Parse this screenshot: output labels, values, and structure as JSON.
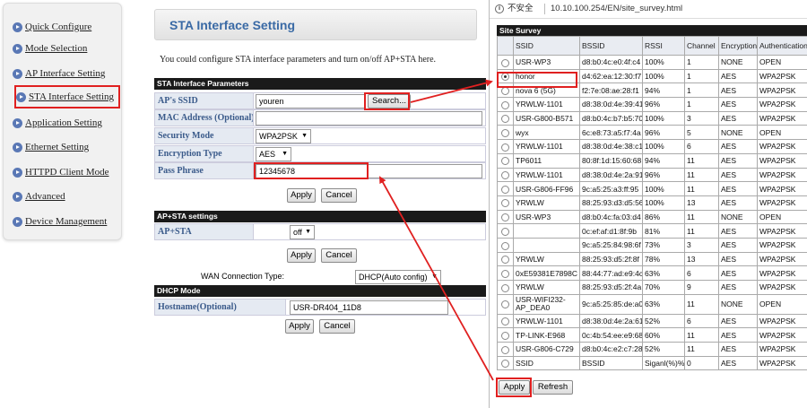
{
  "sidebar": {
    "items": [
      {
        "label": "Quick Configure"
      },
      {
        "label": "Mode Selection"
      },
      {
        "label": "AP Interface Setting"
      },
      {
        "label": "STA Interface Setting"
      },
      {
        "label": "Application Setting"
      },
      {
        "label": "Ethernet Setting"
      },
      {
        "label": "HTTPD Client Mode"
      },
      {
        "label": "Advanced"
      },
      {
        "label": "Device Management"
      }
    ]
  },
  "main": {
    "title": "STA Interface Setting",
    "description": "You could configure STA interface parameters and turn on/off AP+STA here.",
    "sta_params": {
      "header": "STA Interface Parameters",
      "ssid_label": "AP's SSID",
      "ssid_value": "youren",
      "search_label": "Search...",
      "mac_label": "MAC Address (Optional)",
      "mac_value": "",
      "security_label": "Security Mode",
      "security_value": "WPA2PSK",
      "encryption_label": "Encryption Type",
      "encryption_value": "AES",
      "pass_label": "Pass Phrase",
      "pass_value": "12345678",
      "apply_label": "Apply",
      "cancel_label": "Cancel"
    },
    "apsta": {
      "header": "AP+STA settings",
      "label": "AP+STA",
      "value": "off",
      "apply_label": "Apply",
      "cancel_label": "Cancel"
    },
    "wan": {
      "label": "WAN Connection Type:",
      "value": "DHCP(Auto config)"
    },
    "dhcp": {
      "header": "DHCP Mode",
      "hostname_label": "Hostname(Optional)",
      "hostname_value": "USR-DR404_11D8",
      "apply_label": "Apply",
      "cancel_label": "Cancel"
    }
  },
  "browser": {
    "security_text": "不安全",
    "url": "10.10.100.254/EN/site_survey.html"
  },
  "site_survey": {
    "header": "Site Survey",
    "columns": [
      "",
      "SSID",
      "BSSID",
      "RSSI",
      "Channel",
      "Encryption",
      "Authentication"
    ],
    "rows": [
      [
        "USR-WP3",
        "d8:b0:4c:e0:4f:c4",
        "100%",
        "1",
        "NONE",
        "OPEN"
      ],
      [
        "honor",
        "d4:62:ea:12:30:f7",
        "100%",
        "1",
        "AES",
        "WPA2PSK"
      ],
      [
        "nova 6 (5G)",
        "f2:7e:08:ae:28:f1",
        "94%",
        "1",
        "AES",
        "WPA2PSK"
      ],
      [
        "YRWLW-1101",
        "d8:38:0d:4e:39:41",
        "96%",
        "1",
        "AES",
        "WPA2PSK"
      ],
      [
        "USR-G800-B571",
        "d8:b0:4c:b7:b5:70",
        "100%",
        "3",
        "AES",
        "WPA2PSK"
      ],
      [
        "wyx",
        "6c:e8:73:a5:f7:4a",
        "96%",
        "5",
        "NONE",
        "OPEN"
      ],
      [
        "YRWLW-1101",
        "d8:38:0d:4e:38:c1",
        "100%",
        "6",
        "AES",
        "WPA2PSK"
      ],
      [
        "TP6011",
        "80:8f:1d:15:60:68",
        "94%",
        "11",
        "AES",
        "WPA2PSK"
      ],
      [
        "YRWLW-1101",
        "d8:38:0d:4e:2a:91",
        "96%",
        "11",
        "AES",
        "WPA2PSK"
      ],
      [
        "USR-G806-FF96",
        "9c:a5:25:a3:ff:95",
        "100%",
        "11",
        "AES",
        "WPA2PSK"
      ],
      [
        "YRWLW",
        "88:25:93:d3:d5:56",
        "100%",
        "13",
        "AES",
        "WPA2PSK"
      ],
      [
        "USR-WP3",
        "d8:b0:4c:fa:03:d4",
        "86%",
        "11",
        "NONE",
        "OPEN"
      ],
      [
        "",
        "0c:ef:af:d1:8f:9b",
        "81%",
        "11",
        "AES",
        "WPA2PSK"
      ],
      [
        "",
        "9c:a5:25:84:98:6f",
        "73%",
        "3",
        "AES",
        "WPA2PSK"
      ],
      [
        "YRWLW",
        "88:25:93:d5:2f:8f",
        "78%",
        "13",
        "AES",
        "WPA2PSK"
      ],
      [
        "0xE59381E7898C",
        "88:44:77:ad:e9:4c",
        "63%",
        "6",
        "AES",
        "WPA2PSK"
      ],
      [
        "YRWLW",
        "88:25:93:d5:2f:4a",
        "70%",
        "9",
        "AES",
        "WPA2PSK"
      ],
      [
        "USR-WIFI232-AP_DEA0",
        "9c:a5:25:85:de:a0",
        "63%",
        "11",
        "NONE",
        "OPEN"
      ],
      [
        "YRWLW-1101",
        "d8:38:0d:4e:2a:61",
        "52%",
        "6",
        "AES",
        "WPA2PSK"
      ],
      [
        "TP-LINK-E968",
        "0c:4b:54:ee:e9:68",
        "60%",
        "11",
        "AES",
        "WPA2PSK"
      ],
      [
        "USR-G806-C729",
        "d8:b0:4c:e2:c7:28",
        "52%",
        "11",
        "AES",
        "WPA2PSK"
      ],
      [
        "SSID",
        "BSSID",
        "Siganl(%)%",
        "0",
        "AES",
        "WPA2PSK"
      ]
    ],
    "apply_label": "Apply",
    "refresh_label": "Refresh"
  },
  "colors": {
    "highlight": "#e02020",
    "title_blue": "#3a6aa5",
    "section_header": "#1a1a1a"
  }
}
